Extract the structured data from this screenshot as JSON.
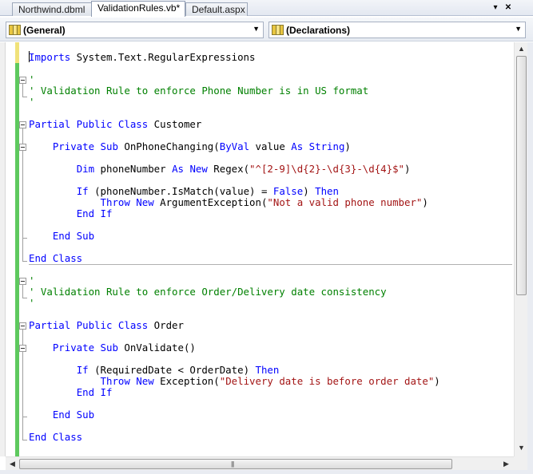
{
  "tabs": [
    {
      "label": "Northwind.dbml",
      "active": false
    },
    {
      "label": "ValidationRules.vb*",
      "active": true
    },
    {
      "label": "Default.aspx",
      "active": false
    }
  ],
  "tab_controls": {
    "scroll_icon": "▾",
    "close_icon": "✕"
  },
  "navbar": {
    "type_combo": {
      "value": "(General)",
      "arrow": "▼"
    },
    "member_combo": {
      "value": "(Declarations)",
      "arrow": "▼"
    }
  },
  "code": {
    "imports": {
      "kw": "Imports",
      "rest": " System.Text.RegularExpressions"
    },
    "c1_blank": "'",
    "c1_text": "' Validation Rule to enforce Phone Number is in US format",
    "c1_blank2": "'",
    "class1": {
      "kw": "Partial Public Class",
      "name": " Customer"
    },
    "sub1": {
      "kw1": "Private Sub",
      "sig": " OnPhoneChanging(",
      "kw2": "ByVal",
      "mid": " value ",
      "kw3": "As String",
      "end": ")"
    },
    "dim": {
      "kw1": "Dim",
      "name": " phoneNumber ",
      "kw2": "As New",
      "call": " Regex(",
      "str": "\"^[2-9]\\d{2}-\\d{3}-\\d{4}$\"",
      "end": ")"
    },
    "if1": {
      "kw1": "If",
      "cond": " (phoneNumber.IsMatch(value) = ",
      "kw2": "False",
      "close": ") ",
      "kw3": "Then"
    },
    "throw1": {
      "kw": "Throw New",
      "call": " ArgumentException(",
      "str": "\"Not a valid phone number\"",
      "end": ")"
    },
    "endif1": "End If",
    "endsub1": "End Sub",
    "endclass1": "End Class",
    "c2_blank": "'",
    "c2_text": "' Validation Rule to enforce Order/Delivery date consistency",
    "c2_blank2": "'",
    "class2": {
      "kw": "Partial Public Class",
      "name": " Order"
    },
    "sub2": {
      "kw": "Private Sub",
      "sig": " OnValidate()"
    },
    "if2": {
      "kw1": "If",
      "cond": " (RequiredDate < OrderDate) ",
      "kw2": "Then"
    },
    "throw2": {
      "kw": "Throw New",
      "call": " Exception(",
      "str": "\"Delivery date is before order date\"",
      "end": ")"
    },
    "endif2": "End If",
    "endsub2": "End Sub",
    "endclass2": "End Class"
  },
  "scrollbars": {
    "up": "▲",
    "down": "▼",
    "left": "◀",
    "right": "▶",
    "grip": "|||"
  },
  "colors": {
    "keyword": "#0000ff",
    "comment": "#008000",
    "string": "#a31515",
    "change_saved": "#5ec95e",
    "change_unsaved": "#f0e27a"
  }
}
